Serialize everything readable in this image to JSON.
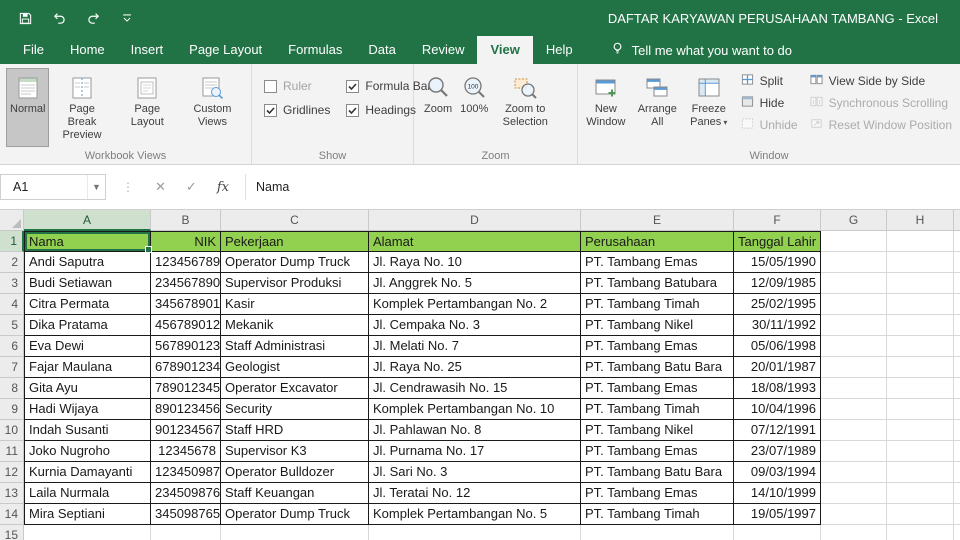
{
  "colors": {
    "accent": "#217346",
    "header_fill": "#92D050"
  },
  "title_bar": {
    "title": "DAFTAR KARYAWAN PERUSAHAAN TAMBANG  -  Excel"
  },
  "tabs": [
    "File",
    "Home",
    "Insert",
    "Page Layout",
    "Formulas",
    "Data",
    "Review",
    "View",
    "Help"
  ],
  "active_tab": "View",
  "tell_me": "Tell me what you want to do",
  "ribbon": {
    "workbook_views": {
      "label": "Workbook Views",
      "normal": "Normal",
      "page_break_preview": "Page Break Preview",
      "page_layout": "Page Layout",
      "custom_views": "Custom Views"
    },
    "show": {
      "label": "Show",
      "ruler": "Ruler",
      "formula_bar": "Formula Bar",
      "gridlines": "Gridlines",
      "headings": "Headings",
      "ruler_checked": false,
      "formula_bar_checked": true,
      "gridlines_checked": true,
      "headings_checked": true
    },
    "zoom": {
      "label": "Zoom",
      "zoom": "Zoom",
      "hundred": "100%",
      "hundred_icon": "100",
      "zoom_to_selection": "Zoom to Selection"
    },
    "window": {
      "label": "Window",
      "new_window": "New Window",
      "arrange_all": "Arrange All",
      "freeze_panes": "Freeze Panes",
      "split": "Split",
      "hide": "Hide",
      "unhide": "Unhide",
      "view_side_by_side": "View Side by Side",
      "synchronous_scrolling": "Synchronous Scrolling",
      "reset_window_position": "Reset Window Position"
    }
  },
  "formula_bar": {
    "name_box": "A1",
    "fx_label": "fx",
    "formula": "Nama"
  },
  "sheet": {
    "columns": [
      "A",
      "B",
      "C",
      "D",
      "E",
      "F",
      "G",
      "H"
    ],
    "row_numbers": [
      1,
      2,
      3,
      4,
      5,
      6,
      7,
      8,
      9,
      10,
      11,
      12,
      13,
      14,
      15
    ],
    "selected_cell": "A1",
    "header_row": [
      "Nama",
      "NIK",
      "Pekerjaan",
      "Alamat",
      "Perusahaan",
      "Tanggal Lahir"
    ],
    "data": [
      [
        "Andi Saputra",
        "123456789",
        "Operator Dump Truck",
        "Jl. Raya No. 10",
        "PT. Tambang Emas",
        "15/05/1990"
      ],
      [
        "Budi Setiawan",
        "234567890",
        "Supervisor Produksi",
        "Jl. Anggrek No. 5",
        "PT. Tambang Batubara",
        "12/09/1985"
      ],
      [
        "Citra Permata",
        "345678901",
        "Kasir",
        "Komplek Pertambangan No. 2",
        "PT. Tambang Timah",
        "25/02/1995"
      ],
      [
        "Dika Pratama",
        "456789012",
        "Mekanik",
        "Jl. Cempaka No. 3",
        "PT. Tambang Nikel",
        "30/11/1992"
      ],
      [
        "Eva Dewi",
        "567890123",
        "Staff Administrasi",
        "Jl. Melati No. 7",
        "PT. Tambang Emas",
        "05/06/1998"
      ],
      [
        "Fajar Maulana",
        "678901234",
        "Geologist",
        "Jl. Raya No. 25",
        "PT. Tambang Batu Bara",
        "20/01/1987"
      ],
      [
        "Gita Ayu",
        "789012345",
        "Operator Excavator",
        "Jl. Cendrawasih No. 15",
        "PT. Tambang Emas",
        "18/08/1993"
      ],
      [
        "Hadi Wijaya",
        "890123456",
        "Security",
        "Komplek Pertambangan No. 10",
        "PT. Tambang Timah",
        "10/04/1996"
      ],
      [
        "Indah Susanti",
        "901234567",
        "Staff HRD",
        "Jl. Pahlawan No. 8",
        "PT. Tambang Nikel",
        "07/12/1991"
      ],
      [
        "Joko Nugroho",
        "12345678",
        "Supervisor K3",
        "Jl. Purnama No. 17",
        "PT. Tambang Emas",
        "23/07/1989"
      ],
      [
        "Kurnia Damayanti",
        "123450987",
        "Operator Bulldozer",
        "Jl. Sari No. 3",
        "PT. Tambang Batu Bara",
        "09/03/1994"
      ],
      [
        "Laila Nurmala",
        "234509876",
        "Staff Keuangan",
        "Jl. Teratai No. 12",
        "PT. Tambang Emas",
        "14/10/1999"
      ],
      [
        "Mira Septiani",
        "345098765",
        "Operator Dump Truck",
        "Komplek Pertambangan No. 5",
        "PT. Tambang Timah",
        "19/05/1997"
      ]
    ]
  }
}
